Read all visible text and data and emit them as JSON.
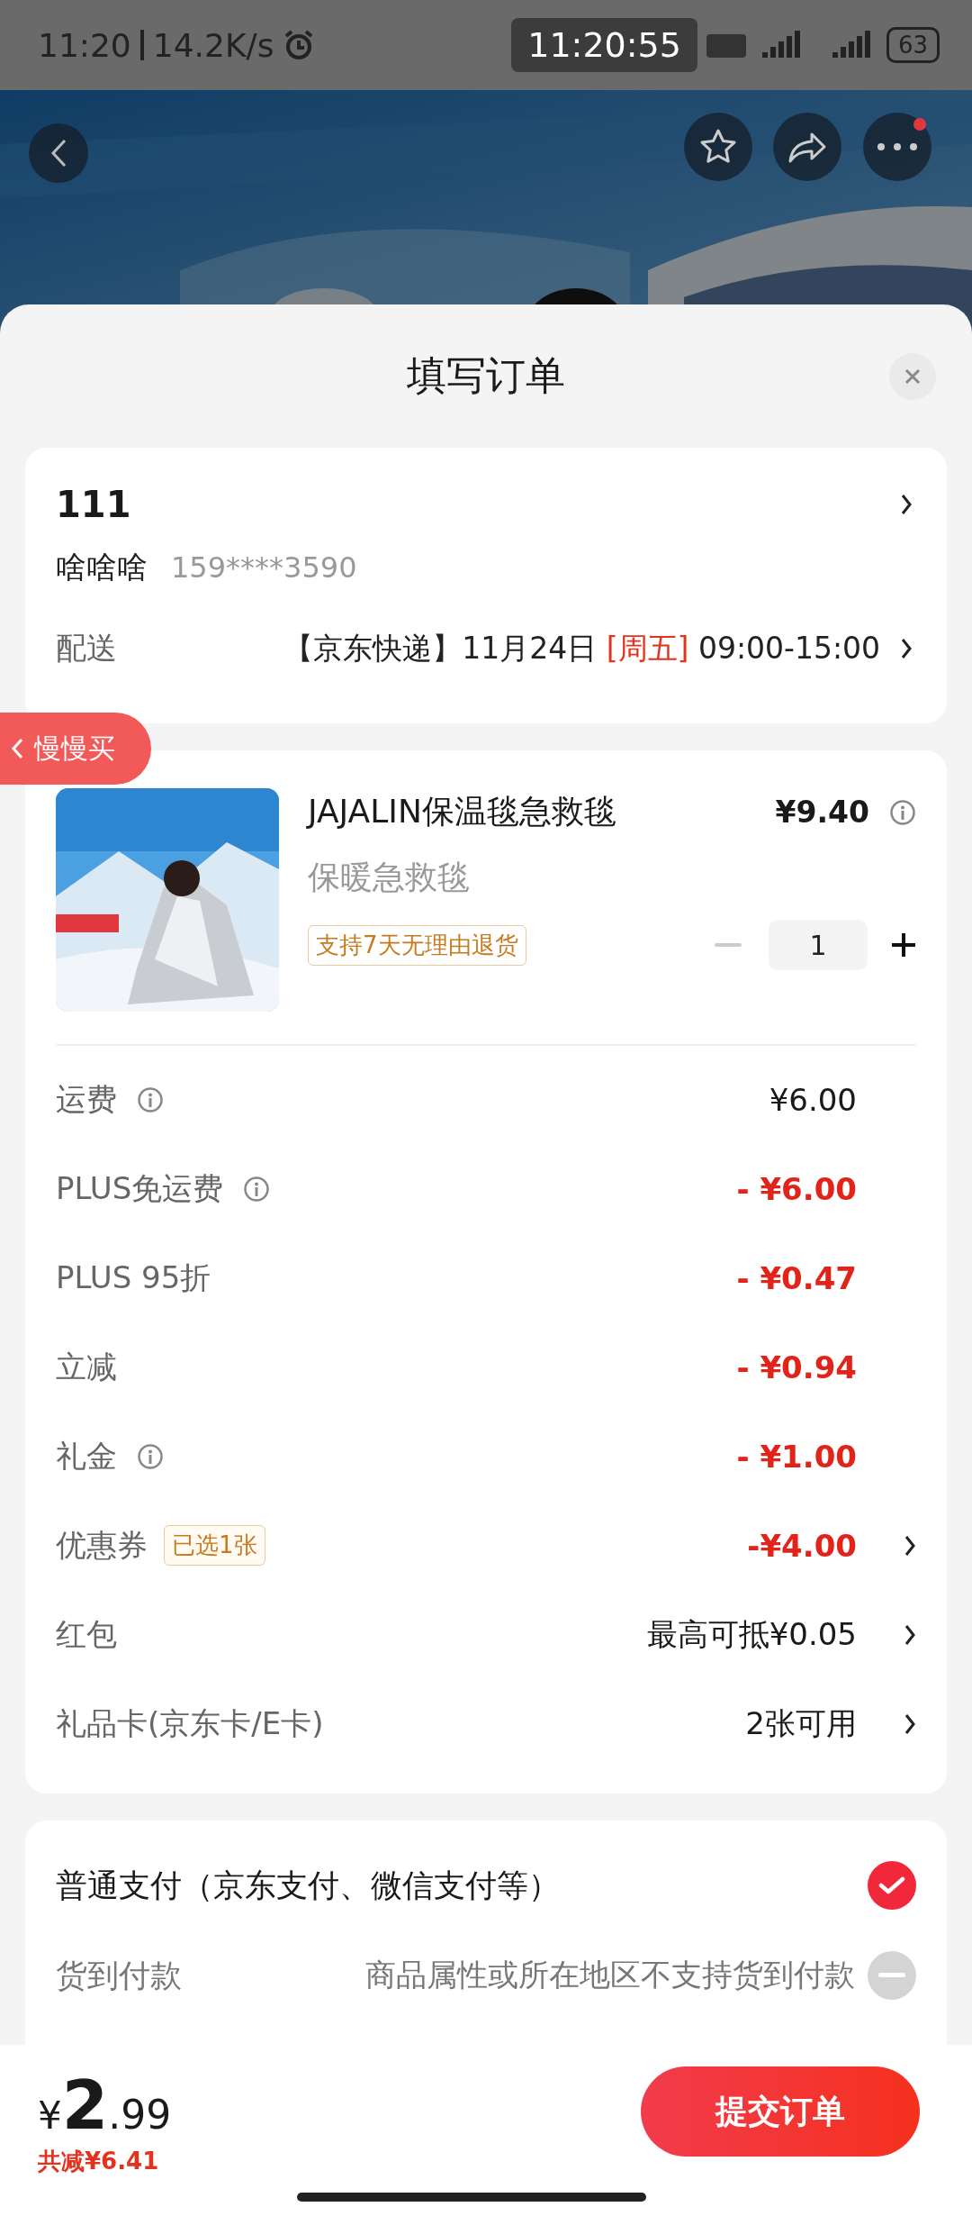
{
  "status_bar": {
    "time": "11:20",
    "network_speed": "14.2K/s",
    "clock_pill": "11:20:55",
    "battery": "63"
  },
  "sheet": {
    "title": "填写订单"
  },
  "address": {
    "name": "111",
    "contact_name": "啥啥啥",
    "phone": "159****3590",
    "delivery_label": "配送",
    "carrier_date": "【京东快递】11月24日",
    "weekday": "[周五]",
    "time_window": "09:00-15:00"
  },
  "side_tab": {
    "label": "慢慢买"
  },
  "product": {
    "title": "JAJALIN保温毯急救毯",
    "subtitle": "保暖急救毯",
    "price": "¥9.40",
    "tag": "支持7天无理由退货",
    "quantity": "1"
  },
  "fees": [
    {
      "label": "运费",
      "info_icon": true,
      "value": "¥6.00",
      "highlight": false,
      "chevron": false
    },
    {
      "label": "PLUS免运费",
      "info_icon": true,
      "value": "- ¥6.00",
      "highlight": true,
      "chevron": false
    },
    {
      "label": "PLUS 95折",
      "info_icon": false,
      "value": "- ¥0.47",
      "highlight": true,
      "chevron": false
    },
    {
      "label": "立减",
      "info_icon": false,
      "value": "- ¥0.94",
      "highlight": true,
      "chevron": false
    },
    {
      "label": "礼金",
      "info_icon": true,
      "value": "- ¥1.00",
      "highlight": true,
      "chevron": false
    },
    {
      "label": "优惠券",
      "info_icon": false,
      "badge": "已选1张",
      "value": "-¥4.00",
      "highlight": true,
      "chevron": true
    },
    {
      "label": "红包",
      "info_icon": false,
      "value": "最高可抵¥0.05",
      "highlight": false,
      "chevron": true
    },
    {
      "label": "礼品卡(京东卡/E卡)",
      "info_icon": false,
      "value": "2张可用",
      "highlight": false,
      "chevron": true
    }
  ],
  "payment": [
    {
      "label": "普通支付（京东支付、微信支付等）",
      "selected": true,
      "disabled": false
    },
    {
      "label": "货到付款",
      "note": "商品属性或所在地区不支持货到付款",
      "selected": false,
      "disabled": true
    }
  ],
  "footer": {
    "currency": "¥",
    "total_integer": "2",
    "total_decimal": ".99",
    "savings": "共减¥6.41",
    "submit": "提交订单"
  }
}
